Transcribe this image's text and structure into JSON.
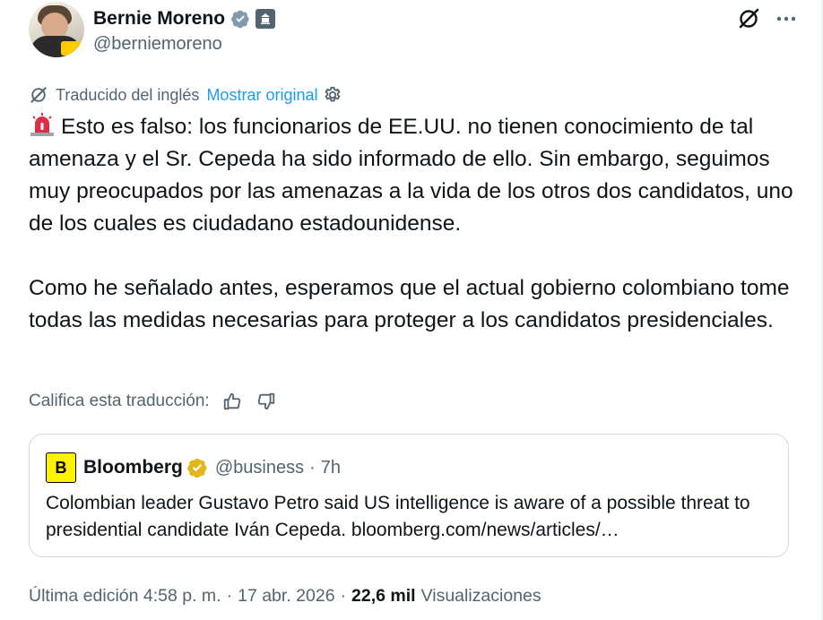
{
  "post": {
    "author": {
      "name": "Bernie Moreno",
      "handle": "@berniemoreno"
    },
    "translation": {
      "notice": "Traducido del inglés",
      "show_original": "Mostrar original"
    },
    "body": {
      "emoji": "rotating-light",
      "paragraph1": "Esto es falso: los funcionarios de EE.UU. no tienen conocimiento de tal amenaza y el Sr. Cepeda ha sido informado de ello. Sin embargo, seguimos muy preocupados por las amenazas a la vida de los otros dos candidatos, uno de los cuales es ciudadano estadounidense.",
      "paragraph2": "Como he señalado antes, esperamos que el actual gobierno colombiano tome todas las medidas necesarias para proteger a los candidatos presidenciales."
    },
    "rate_translation": {
      "label": "Califica esta traducción:"
    },
    "quote": {
      "logo_letter": "B",
      "name": "Bloomberg",
      "handle": "@business",
      "separator": "·",
      "time": "7h",
      "text": "Colombian leader Gustavo Petro said US intelligence is aware of a possible threat to presidential candidate Iván Cepeda. bloomberg.com/news/articles/…"
    },
    "footer": {
      "edited": "Última edición 4:58 p. m.",
      "date": "17 abr. 2026",
      "views_count": "22,6 mil",
      "views_label": "Visualizaciones",
      "separator": "·"
    }
  },
  "icons": {
    "verified": "gray-verified-badge-icon",
    "affiliate": "government-affiliate-icon",
    "grok": "grok-icon",
    "more": "more-options-icon",
    "translate": "translate-icon",
    "settings": "gear-icon",
    "thumbs_up": "thumbs-up-icon",
    "thumbs_down": "thumbs-down-icon",
    "quote_verified": "gold-verified-badge-icon"
  },
  "colors": {
    "link": "#1d9bf0",
    "secondary_text": "#536471",
    "primary_text": "#0f1419",
    "gold_badge": "#e2b719",
    "bloomberg_yellow": "#fff200"
  }
}
